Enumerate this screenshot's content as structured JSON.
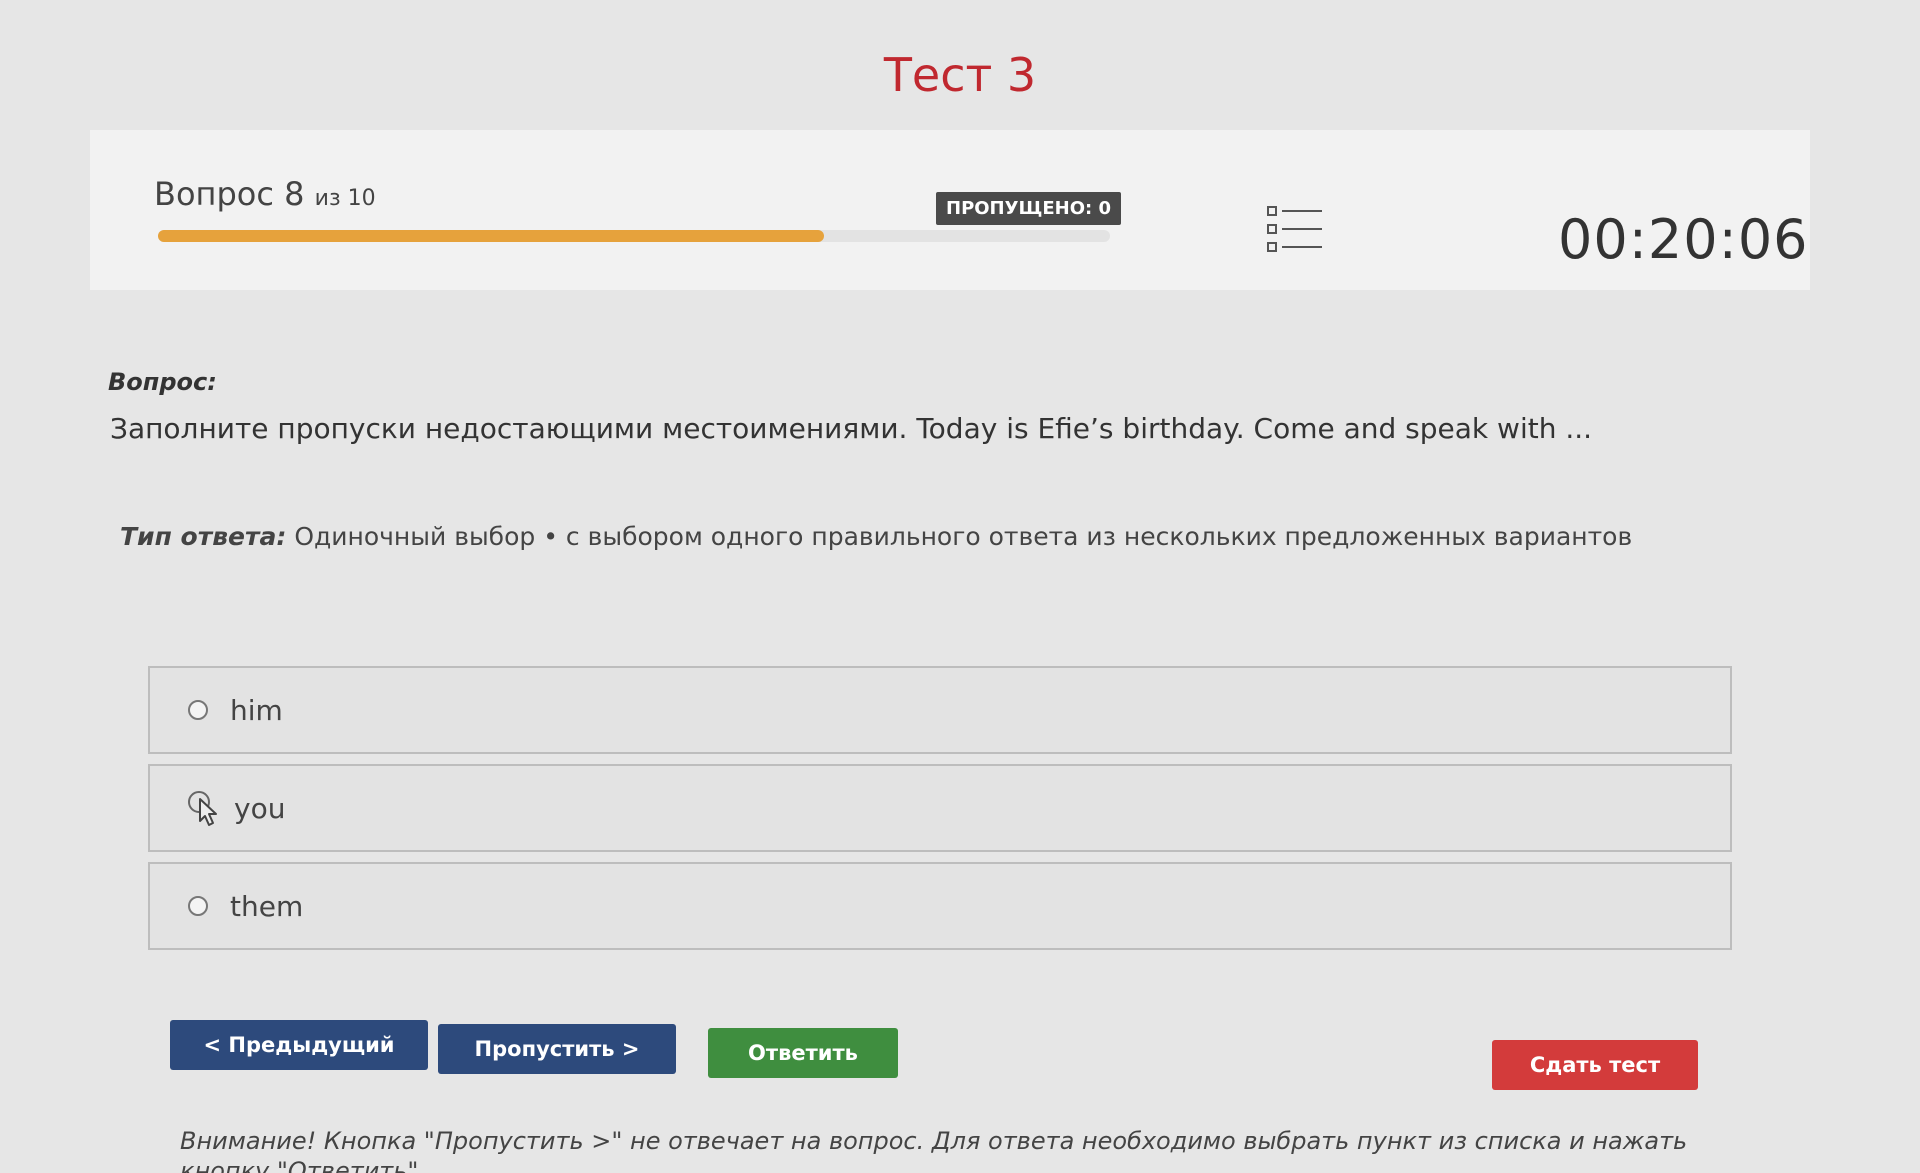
{
  "header": {
    "title": "Тест 3"
  },
  "status": {
    "question_label": "Вопрос 8",
    "question_of": "из 10",
    "progress_fraction": 0.7,
    "skipped_label": "ПРОПУЩЕНО: 0",
    "list_icon": "list-icon",
    "timer": "00:20:06",
    "colors": {
      "progress": "#e6a23c"
    }
  },
  "question": {
    "label": "Вопрос:",
    "text": "Заполните пропуски недостающими местоимениями. Today is Efie’s birthday. Come and speak with ..."
  },
  "answer_type": {
    "label": "Тип ответа:",
    "value": "Одиночный выбор • с выбором одного правильного ответа из нескольких предложенных вариантов"
  },
  "options": [
    {
      "text": "him"
    },
    {
      "text": "you"
    },
    {
      "text": "them"
    }
  ],
  "buttons": {
    "prev": "< Предыдущий",
    "skip": "Пропустить >",
    "answer": "Ответить",
    "submit": "Сдать тест",
    "colors": {
      "prev": "#2d4a7c",
      "skip": "#2d4a7c",
      "answer": "#3f8e3f",
      "submit": "#d33b3b"
    }
  },
  "notice": "Внимание! Кнопка \"Пропустить >\" не отвечает на вопрос. Для ответа необходимо выбрать пункт из списка и нажать кнопку \"Ответить\""
}
